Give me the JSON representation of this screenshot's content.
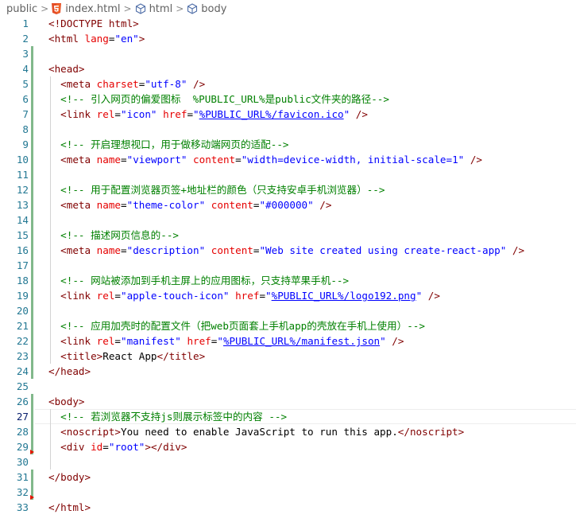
{
  "breadcrumb": {
    "items": [
      {
        "label": "public",
        "icon": "none"
      },
      {
        "label": "index.html",
        "icon": "html5-icon"
      },
      {
        "label": "html",
        "icon": "cube-icon"
      },
      {
        "label": "body",
        "icon": "cube-icon"
      }
    ],
    "separator": ">"
  },
  "colors": {
    "line_number": "#237893",
    "tag": "#800000",
    "attribute": "#e50000",
    "value": "#0000ff",
    "comment": "#008000",
    "gutter_modified": "#81b88b",
    "gutter_deleted": "#e51400",
    "html5_orange": "#e44d26"
  },
  "editor": {
    "active_line": 27,
    "lines": [
      {
        "n": "1",
        "tokens": [
          [
            "doctype",
            "<!DOCTYPE "
          ],
          [
            "tag",
            "html"
          ],
          [
            "doctype",
            ">"
          ]
        ]
      },
      {
        "n": "2",
        "tokens": [
          [
            "tag",
            "<html "
          ],
          [
            "attr",
            "lang"
          ],
          [
            "txt",
            "="
          ],
          [
            "val",
            "\"en\""
          ],
          [
            "tag",
            ">"
          ]
        ]
      },
      {
        "n": "3",
        "tokens": []
      },
      {
        "n": "4",
        "tokens": [
          [
            "tag",
            "<head>"
          ]
        ]
      },
      {
        "n": "5",
        "tokens": [
          [
            "txt",
            "  "
          ],
          [
            "tag",
            "<meta "
          ],
          [
            "attr",
            "charset"
          ],
          [
            "txt",
            "="
          ],
          [
            "val",
            "\"utf-8\""
          ],
          [
            "tag",
            " />"
          ]
        ]
      },
      {
        "n": "6",
        "tokens": [
          [
            "txt",
            "  "
          ],
          [
            "cmt",
            "<!-- 引入网页的偏爱图标  %PUBLIC_URL%是public文件夹的路径-->"
          ]
        ]
      },
      {
        "n": "7",
        "tokens": [
          [
            "txt",
            "  "
          ],
          [
            "tag",
            "<link "
          ],
          [
            "attr",
            "rel"
          ],
          [
            "txt",
            "="
          ],
          [
            "val",
            "\"icon\""
          ],
          [
            "txt",
            " "
          ],
          [
            "attr",
            "href"
          ],
          [
            "txt",
            "="
          ],
          [
            "val",
            "\""
          ],
          [
            "link",
            "%PUBLIC_URL%/favicon.ico"
          ],
          [
            "val",
            "\""
          ],
          [
            "tag",
            " />"
          ]
        ]
      },
      {
        "n": "8",
        "tokens": []
      },
      {
        "n": "9",
        "tokens": [
          [
            "txt",
            "  "
          ],
          [
            "cmt",
            "<!-- 开启理想视口，用于做移动端网页的适配-->"
          ]
        ]
      },
      {
        "n": "10",
        "tokens": [
          [
            "txt",
            "  "
          ],
          [
            "tag",
            "<meta "
          ],
          [
            "attr",
            "name"
          ],
          [
            "txt",
            "="
          ],
          [
            "val",
            "\"viewport\""
          ],
          [
            "txt",
            " "
          ],
          [
            "attr",
            "content"
          ],
          [
            "txt",
            "="
          ],
          [
            "val",
            "\"width=device-width, initial-scale=1\""
          ],
          [
            "tag",
            " />"
          ]
        ]
      },
      {
        "n": "11",
        "tokens": []
      },
      {
        "n": "12",
        "tokens": [
          [
            "txt",
            "  "
          ],
          [
            "cmt",
            "<!-- 用于配置浏览器页签+地址栏的颜色（只支持安卓手机浏览器）-->"
          ]
        ]
      },
      {
        "n": "13",
        "tokens": [
          [
            "txt",
            "  "
          ],
          [
            "tag",
            "<meta "
          ],
          [
            "attr",
            "name"
          ],
          [
            "txt",
            "="
          ],
          [
            "val",
            "\"theme-color\""
          ],
          [
            "txt",
            " "
          ],
          [
            "attr",
            "content"
          ],
          [
            "txt",
            "="
          ],
          [
            "val",
            "\"#000000\""
          ],
          [
            "tag",
            " />"
          ]
        ]
      },
      {
        "n": "14",
        "tokens": []
      },
      {
        "n": "15",
        "tokens": [
          [
            "txt",
            "  "
          ],
          [
            "cmt",
            "<!-- 描述网页信息的-->"
          ]
        ]
      },
      {
        "n": "16",
        "tokens": [
          [
            "txt",
            "  "
          ],
          [
            "tag",
            "<meta "
          ],
          [
            "attr",
            "name"
          ],
          [
            "txt",
            "="
          ],
          [
            "val",
            "\"description\""
          ],
          [
            "txt",
            " "
          ],
          [
            "attr",
            "content"
          ],
          [
            "txt",
            "="
          ],
          [
            "val",
            "\"Web site created using create-react-app\""
          ],
          [
            "tag",
            " />"
          ]
        ]
      },
      {
        "n": "17",
        "tokens": []
      },
      {
        "n": "18",
        "tokens": [
          [
            "txt",
            "  "
          ],
          [
            "cmt",
            "<!-- 网站被添加到手机主屏上的应用图标，只支持苹果手机-->"
          ]
        ]
      },
      {
        "n": "19",
        "tokens": [
          [
            "txt",
            "  "
          ],
          [
            "tag",
            "<link "
          ],
          [
            "attr",
            "rel"
          ],
          [
            "txt",
            "="
          ],
          [
            "val",
            "\"apple-touch-icon\""
          ],
          [
            "txt",
            " "
          ],
          [
            "attr",
            "href"
          ],
          [
            "txt",
            "="
          ],
          [
            "val",
            "\""
          ],
          [
            "link",
            "%PUBLIC_URL%/logo192.png"
          ],
          [
            "val",
            "\""
          ],
          [
            "tag",
            " />"
          ]
        ]
      },
      {
        "n": "20",
        "tokens": []
      },
      {
        "n": "21",
        "tokens": [
          [
            "txt",
            "  "
          ],
          [
            "cmt",
            "<!-- 应用加壳时的配置文件（把web页面套上手机app的壳放在手机上使用）-->"
          ]
        ]
      },
      {
        "n": "22",
        "tokens": [
          [
            "txt",
            "  "
          ],
          [
            "tag",
            "<link "
          ],
          [
            "attr",
            "rel"
          ],
          [
            "txt",
            "="
          ],
          [
            "val",
            "\"manifest\""
          ],
          [
            "txt",
            " "
          ],
          [
            "attr",
            "href"
          ],
          [
            "txt",
            "="
          ],
          [
            "val",
            "\""
          ],
          [
            "link",
            "%PUBLIC_URL%/manifest.json"
          ],
          [
            "val",
            "\""
          ],
          [
            "tag",
            " />"
          ]
        ]
      },
      {
        "n": "23",
        "tokens": [
          [
            "txt",
            "  "
          ],
          [
            "tag",
            "<title>"
          ],
          [
            "txt",
            "React App"
          ],
          [
            "tag",
            "</title>"
          ]
        ]
      },
      {
        "n": "24",
        "tokens": [
          [
            "tag",
            "</head>"
          ]
        ]
      },
      {
        "n": "25",
        "tokens": []
      },
      {
        "n": "26",
        "tokens": [
          [
            "tag",
            "<body>"
          ]
        ]
      },
      {
        "n": "27",
        "tokens": [
          [
            "txt",
            "  "
          ],
          [
            "cmt",
            "<!-- 若浏览器不支持js则展示标签中的内容 -->"
          ]
        ]
      },
      {
        "n": "28",
        "tokens": [
          [
            "txt",
            "  "
          ],
          [
            "tag",
            "<noscript>"
          ],
          [
            "txt",
            "You need to enable JavaScript to run this app."
          ],
          [
            "tag",
            "</noscript>"
          ]
        ]
      },
      {
        "n": "29",
        "tokens": [
          [
            "txt",
            "  "
          ],
          [
            "tag",
            "<div "
          ],
          [
            "attr",
            "id"
          ],
          [
            "txt",
            "="
          ],
          [
            "val",
            "\"root\""
          ],
          [
            "tag",
            "></div>"
          ]
        ]
      },
      {
        "n": "30",
        "tokens": []
      },
      {
        "n": "31",
        "tokens": [
          [
            "tag",
            "</body>"
          ]
        ]
      },
      {
        "n": "32",
        "tokens": []
      },
      {
        "n": "33",
        "tokens": [
          [
            "tag",
            "</html>"
          ]
        ]
      }
    ]
  }
}
